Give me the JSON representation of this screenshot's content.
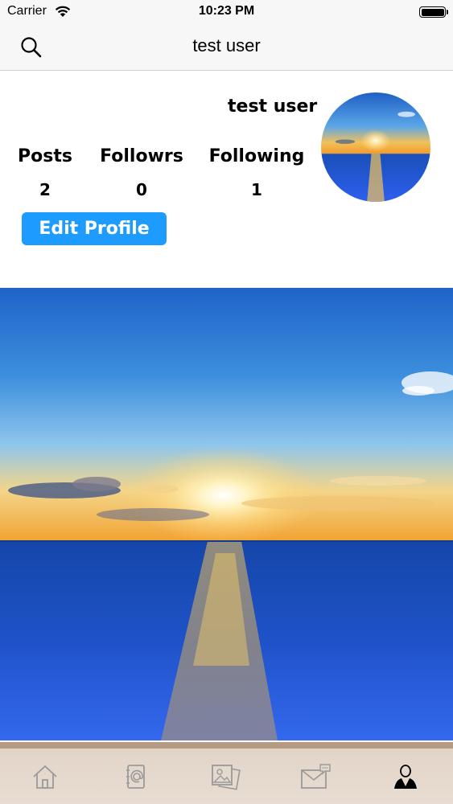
{
  "status_bar": {
    "carrier": "Carrier",
    "time": "10:23 PM",
    "battery_level": 1.0
  },
  "nav": {
    "title": "test user",
    "search_icon": "search-icon"
  },
  "profile": {
    "name": "test user",
    "stats": [
      {
        "label": "Posts",
        "value": "2"
      },
      {
        "label": "Followrs",
        "value": "0"
      },
      {
        "label": "Following",
        "value": "1"
      }
    ],
    "edit_button": "Edit Profile",
    "avatar": "sunset-ocean-photo"
  },
  "post": {
    "image": "sunset-ocean-photo"
  },
  "tabs": [
    {
      "icon": "home-icon",
      "selected": false
    },
    {
      "icon": "contacts-book-icon",
      "selected": false
    },
    {
      "icon": "photos-icon",
      "selected": false
    },
    {
      "icon": "messages-icon",
      "selected": false
    },
    {
      "icon": "profile-user-icon",
      "selected": true
    }
  ],
  "colors": {
    "accent": "#1e9bff",
    "tab_bar": "#e5d9cd",
    "tab_border": "#b79a82",
    "icon_inactive": "#9a9a9a",
    "icon_active": "#000000"
  }
}
